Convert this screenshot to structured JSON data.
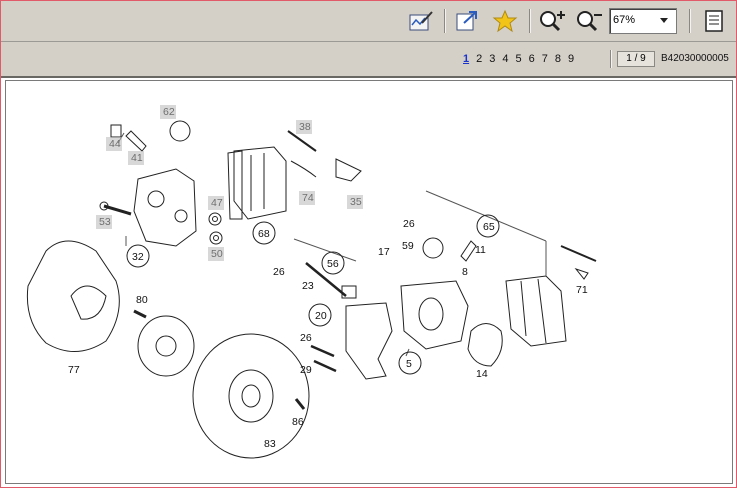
{
  "toolbar": {
    "icons": [
      "edit-annotation-icon",
      "external-link-icon",
      "favorite-star-icon",
      "zoom-in-icon",
      "zoom-out-icon",
      "page-view-icon"
    ],
    "zoom_value": "67%"
  },
  "nav": {
    "pages": [
      "1",
      "2",
      "3",
      "4",
      "5",
      "6",
      "7",
      "8",
      "9"
    ],
    "current_page": "1",
    "page_count": "1 / 9",
    "doc_id": "B42030000005"
  },
  "diagram": {
    "labels": {
      "l44": "44",
      "l41": "41",
      "l62": "62",
      "l38": "38",
      "l74": "74",
      "l35": "35",
      "l53": "53",
      "l47": "47",
      "l68": "68",
      "l32": "32",
      "l50": "50",
      "l56": "56",
      "l26a": "26",
      "l23": "23",
      "l26b": "26",
      "l65": "65",
      "l17": "17",
      "l59": "59",
      "l11": "11",
      "l8": "8",
      "l80": "80",
      "l20": "20",
      "l26c": "26",
      "l29": "29",
      "l5": "5",
      "l14": "14",
      "l71": "71",
      "l77": "77",
      "l86": "86",
      "l83": "83"
    }
  }
}
